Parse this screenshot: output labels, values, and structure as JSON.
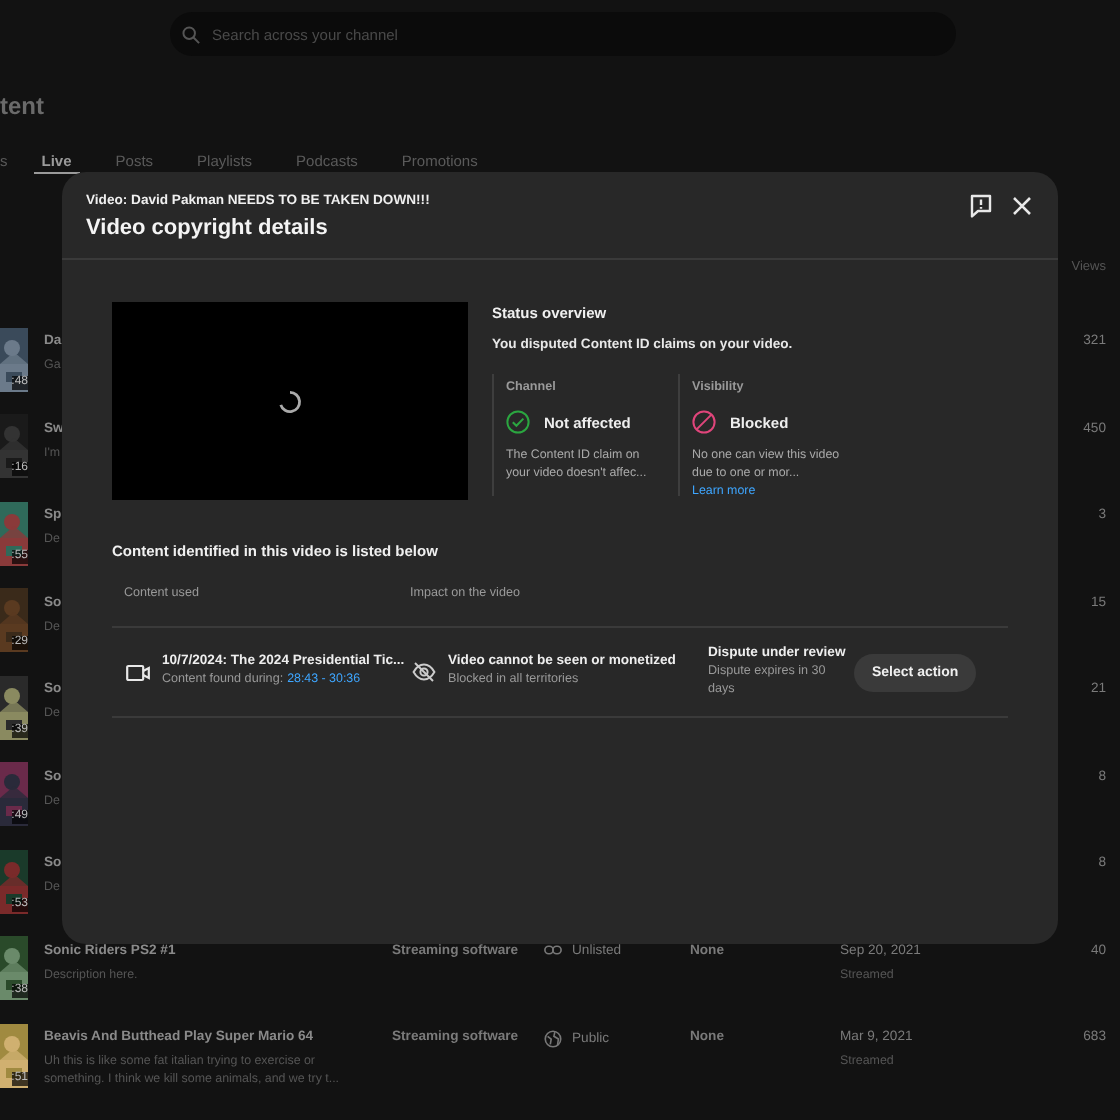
{
  "search": {
    "placeholder": "Search across your channel"
  },
  "page_title": "tent",
  "tabs": [
    {
      "label": "s",
      "selected": false
    },
    {
      "label": "Live",
      "selected": true
    },
    {
      "label": "Posts",
      "selected": false
    },
    {
      "label": "Playlists",
      "selected": false
    },
    {
      "label": "Podcasts",
      "selected": false
    },
    {
      "label": "Promotions",
      "selected": false
    }
  ],
  "table": {
    "views_heading": "Views",
    "rows": [
      {
        "duration": ":48",
        "title": "Da",
        "description": "Ga",
        "views": "321"
      },
      {
        "duration": ":16",
        "title": "Sw",
        "description": "I'm",
        "views": "450"
      },
      {
        "duration": ":55",
        "title": "Sp",
        "description": "De",
        "views": "3"
      },
      {
        "duration": ":29",
        "title": "So",
        "description": "De",
        "views": "15"
      },
      {
        "duration": ":39",
        "title": "So",
        "description": "De",
        "views": "21"
      },
      {
        "duration": ":49",
        "title": "So",
        "description": "De",
        "views": "8"
      },
      {
        "duration": ":53",
        "title": "So",
        "description": "De",
        "views": "8"
      },
      {
        "duration": ":38",
        "title": "Sonic Riders PS2 #1",
        "description": "Description here.",
        "type": "Streaming software",
        "visibility": {
          "kind": "unlisted",
          "label": "Unlisted"
        },
        "restrictions": "None",
        "date": "Sep 20, 2021",
        "date_note": "Streamed",
        "views": "40"
      },
      {
        "duration": ":51",
        "title": "Beavis And Butthead Play Super Mario 64",
        "description": "Uh this is like some fat italian trying to exercise or something. I think we kill some animals, and we try t...",
        "type": "Streaming software",
        "visibility": {
          "kind": "public",
          "label": "Public"
        },
        "restrictions": "None",
        "date": "Mar 9, 2021",
        "date_note": "Streamed",
        "views": "683"
      }
    ]
  },
  "dialog": {
    "subtitle": "Video: David Pakman NEEDS TO BE TAKEN DOWN!!!",
    "title": "Video copyright details",
    "status": {
      "heading": "Status overview",
      "summary": "You disputed Content ID claims on your video.",
      "items": [
        {
          "kind": "ok",
          "label": "Channel",
          "value": "Not affected",
          "description": "The Content ID claim on your video doesn't affec..."
        },
        {
          "kind": "blocked",
          "label": "Visibility",
          "value": "Blocked",
          "description": "No one can view this video due to one or mor...",
          "link": "Learn more"
        }
      ]
    },
    "claims_heading": "Content identified in this video is listed below",
    "columns": [
      "Content used",
      "Impact on the video"
    ],
    "claims": [
      {
        "title": "10/7/2024: The 2024 Presidential Tic...",
        "found_label": "Content found during:",
        "found_range": "28:43 - 30:36",
        "impact": "Video cannot be seen or monetized",
        "impact_detail": "Blocked in all territories",
        "dispute": "Dispute under review",
        "dispute_detail": "Dispute expires in 30 days",
        "action": "Select action"
      }
    ]
  }
}
